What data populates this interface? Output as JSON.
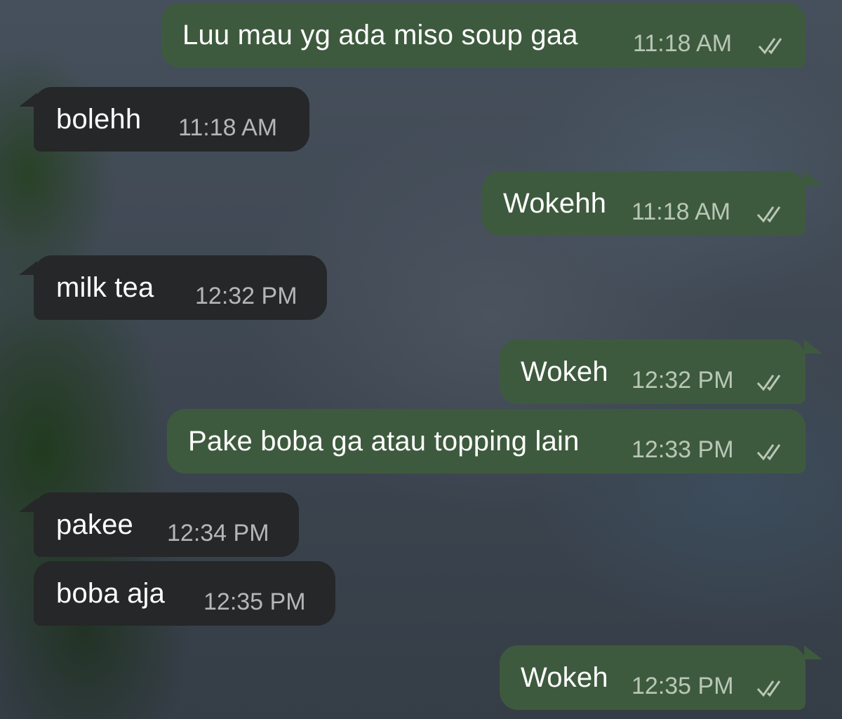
{
  "chat": {
    "messages": [
      {
        "direction": "outgoing",
        "text": "Luu mau yg ada miso soup gaa",
        "time": "11:18 AM",
        "status": "read"
      },
      {
        "direction": "incoming",
        "text": "bolehh",
        "time": "11:18 AM"
      },
      {
        "direction": "outgoing",
        "text": "Wokehh",
        "time": "11:18 AM",
        "status": "read"
      },
      {
        "direction": "incoming",
        "text": "milk tea",
        "time": "12:32 PM"
      },
      {
        "direction": "outgoing",
        "text": "Wokeh",
        "time": "12:32 PM",
        "status": "read"
      },
      {
        "direction": "outgoing",
        "text": "Pake boba ga atau topping lain",
        "time": "12:33 PM",
        "status": "read"
      },
      {
        "direction": "incoming",
        "text": "pakee",
        "time": "12:34 PM"
      },
      {
        "direction": "incoming",
        "text": "boba aja",
        "time": "12:35 PM"
      },
      {
        "direction": "outgoing",
        "text": "Wokeh",
        "time": "12:35 PM",
        "status": "read"
      }
    ],
    "colors": {
      "outgoing_bubble": "#3e5a3e",
      "incoming_bubble": "#262729",
      "message_text": "#ffffff",
      "outgoing_time": "#b9c7b6",
      "incoming_time": "#b5b6b8"
    },
    "icons": {
      "read_status": "double-check-icon"
    }
  }
}
